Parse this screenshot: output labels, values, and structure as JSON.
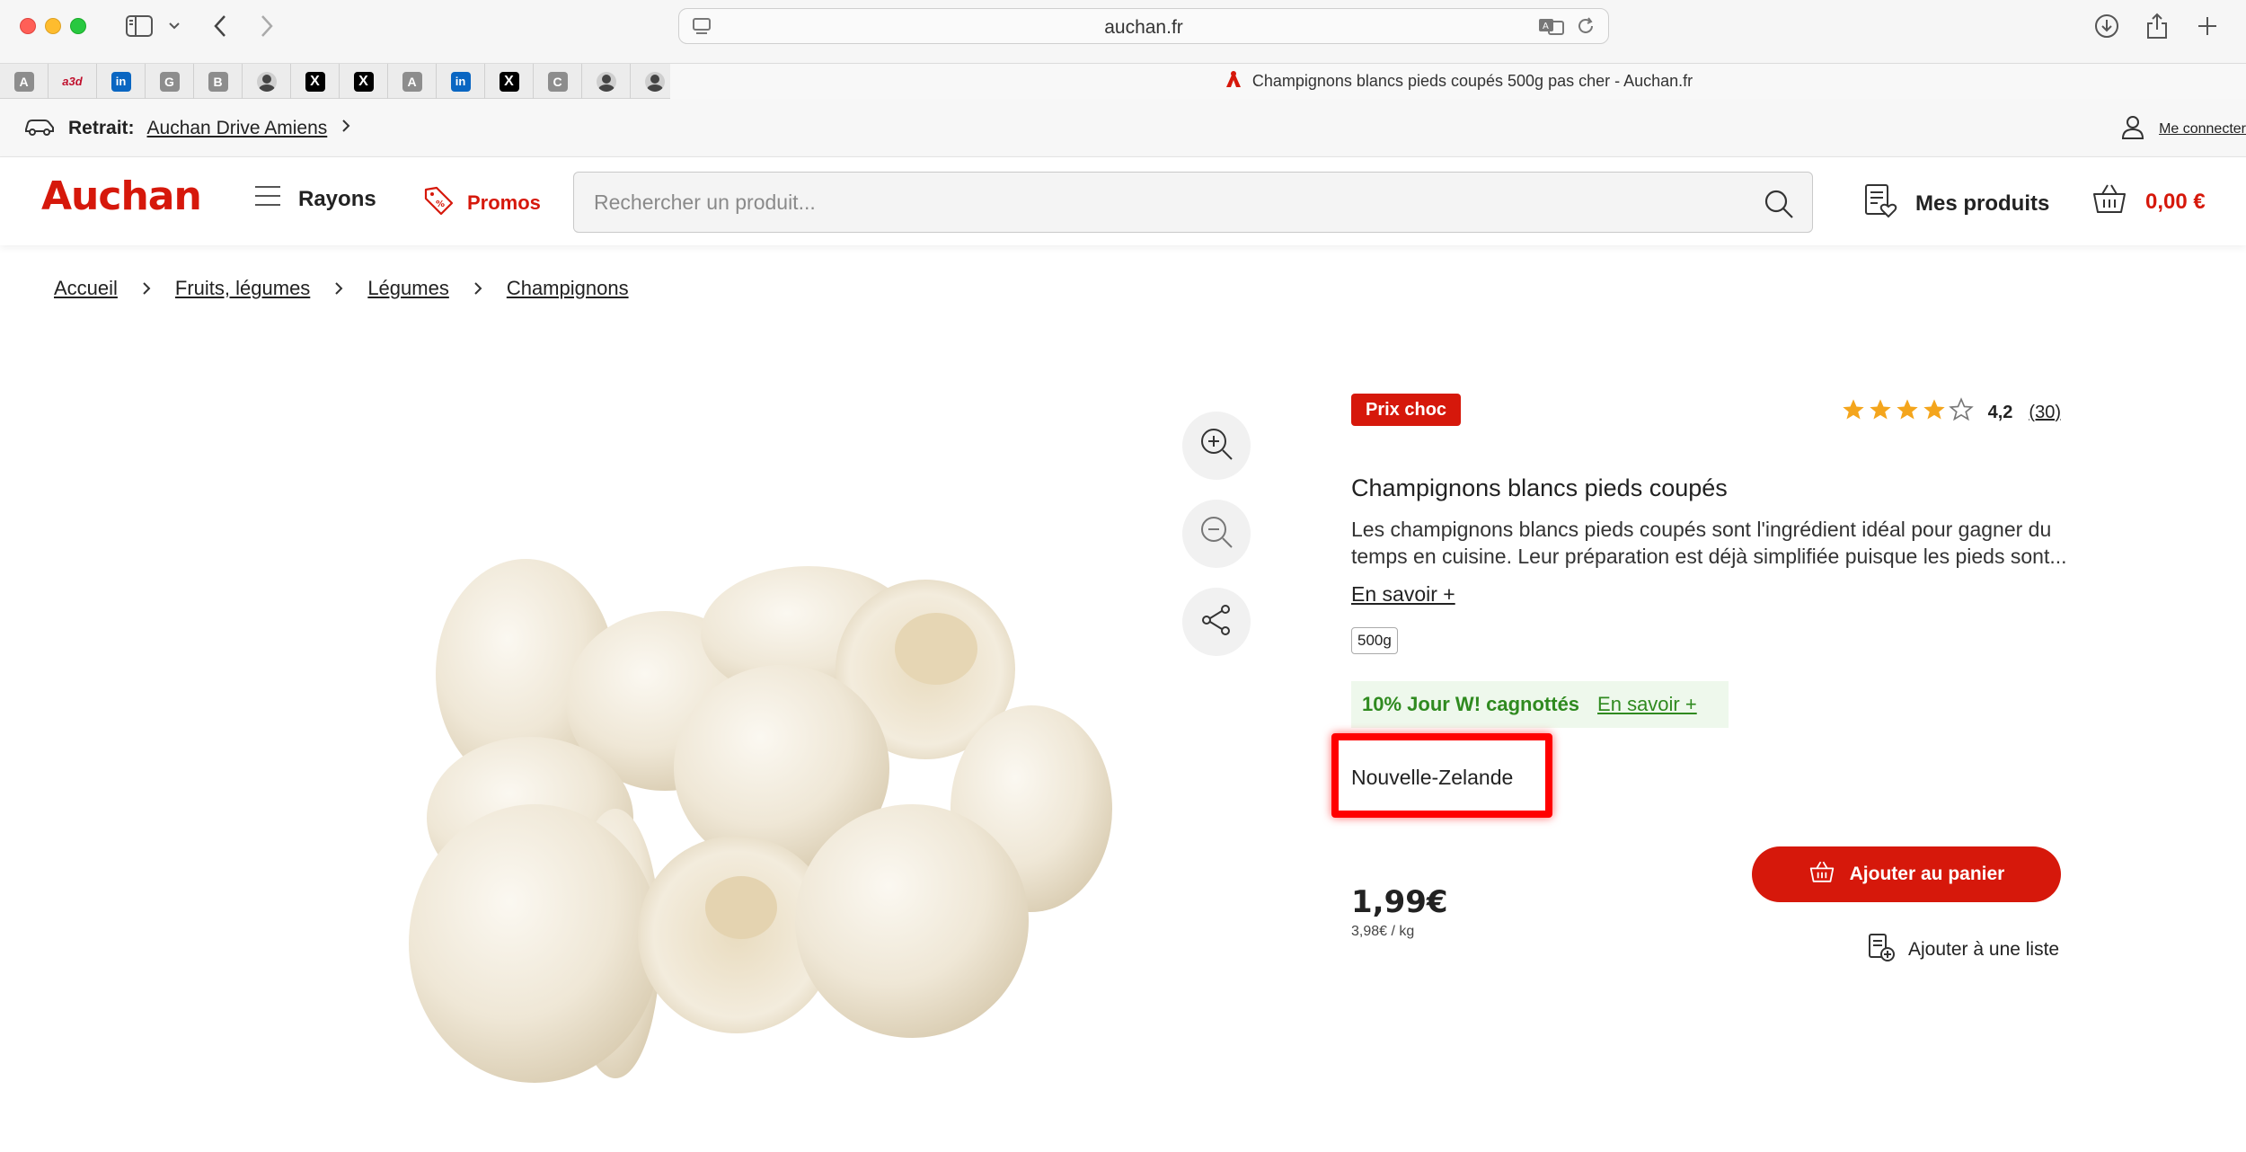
{
  "browser": {
    "url": "auchan.fr",
    "pinned_tabs": [
      "A",
      "a3d",
      "in",
      "G",
      "B",
      "",
      "X",
      "X",
      "A",
      "in",
      "X",
      "C",
      "",
      ""
    ],
    "active_tab_title": "Champignons blancs pieds coupés 500g pas cher - Auchan.fr"
  },
  "site": {
    "retrait_label": "Retrait:",
    "retrait_store": "Auchan Drive Amiens",
    "connect_label": "Me connecter",
    "logo": "Auchan",
    "nav": {
      "rayons": "Rayons",
      "promos": "Promos"
    },
    "search": {
      "placeholder": "Rechercher un produit..."
    },
    "mes_produits": "Mes produits",
    "cart_total": "0,00 €",
    "brand_color": "#d6180b"
  },
  "breadcrumb": [
    "Accueil",
    "Fruits, légumes",
    "Légumes",
    "Champignons"
  ],
  "product": {
    "badge": "Prix choc",
    "rating_value": "4,2",
    "rating_stars": 4.2,
    "rating_count": "(30)",
    "title": "Champignons blancs pieds coupés",
    "description_line1": "Les champignons blancs pieds coupés sont l'ingrédient idéal pour gagner du",
    "description_line2": "temps en cuisine. Leur préparation est déjà simplifiée puisque les pieds sont...",
    "learn_more": "En savoir +",
    "weight": "500g",
    "promo_text": "10% Jour W! cagnottés",
    "promo_link": "En savoir +",
    "origin": "Nouvelle-Zelande",
    "price": "1,99€",
    "unit_price": "3,98€ / kg",
    "add_to_cart": "Ajouter au panier",
    "add_to_list": "Ajouter à une liste"
  }
}
